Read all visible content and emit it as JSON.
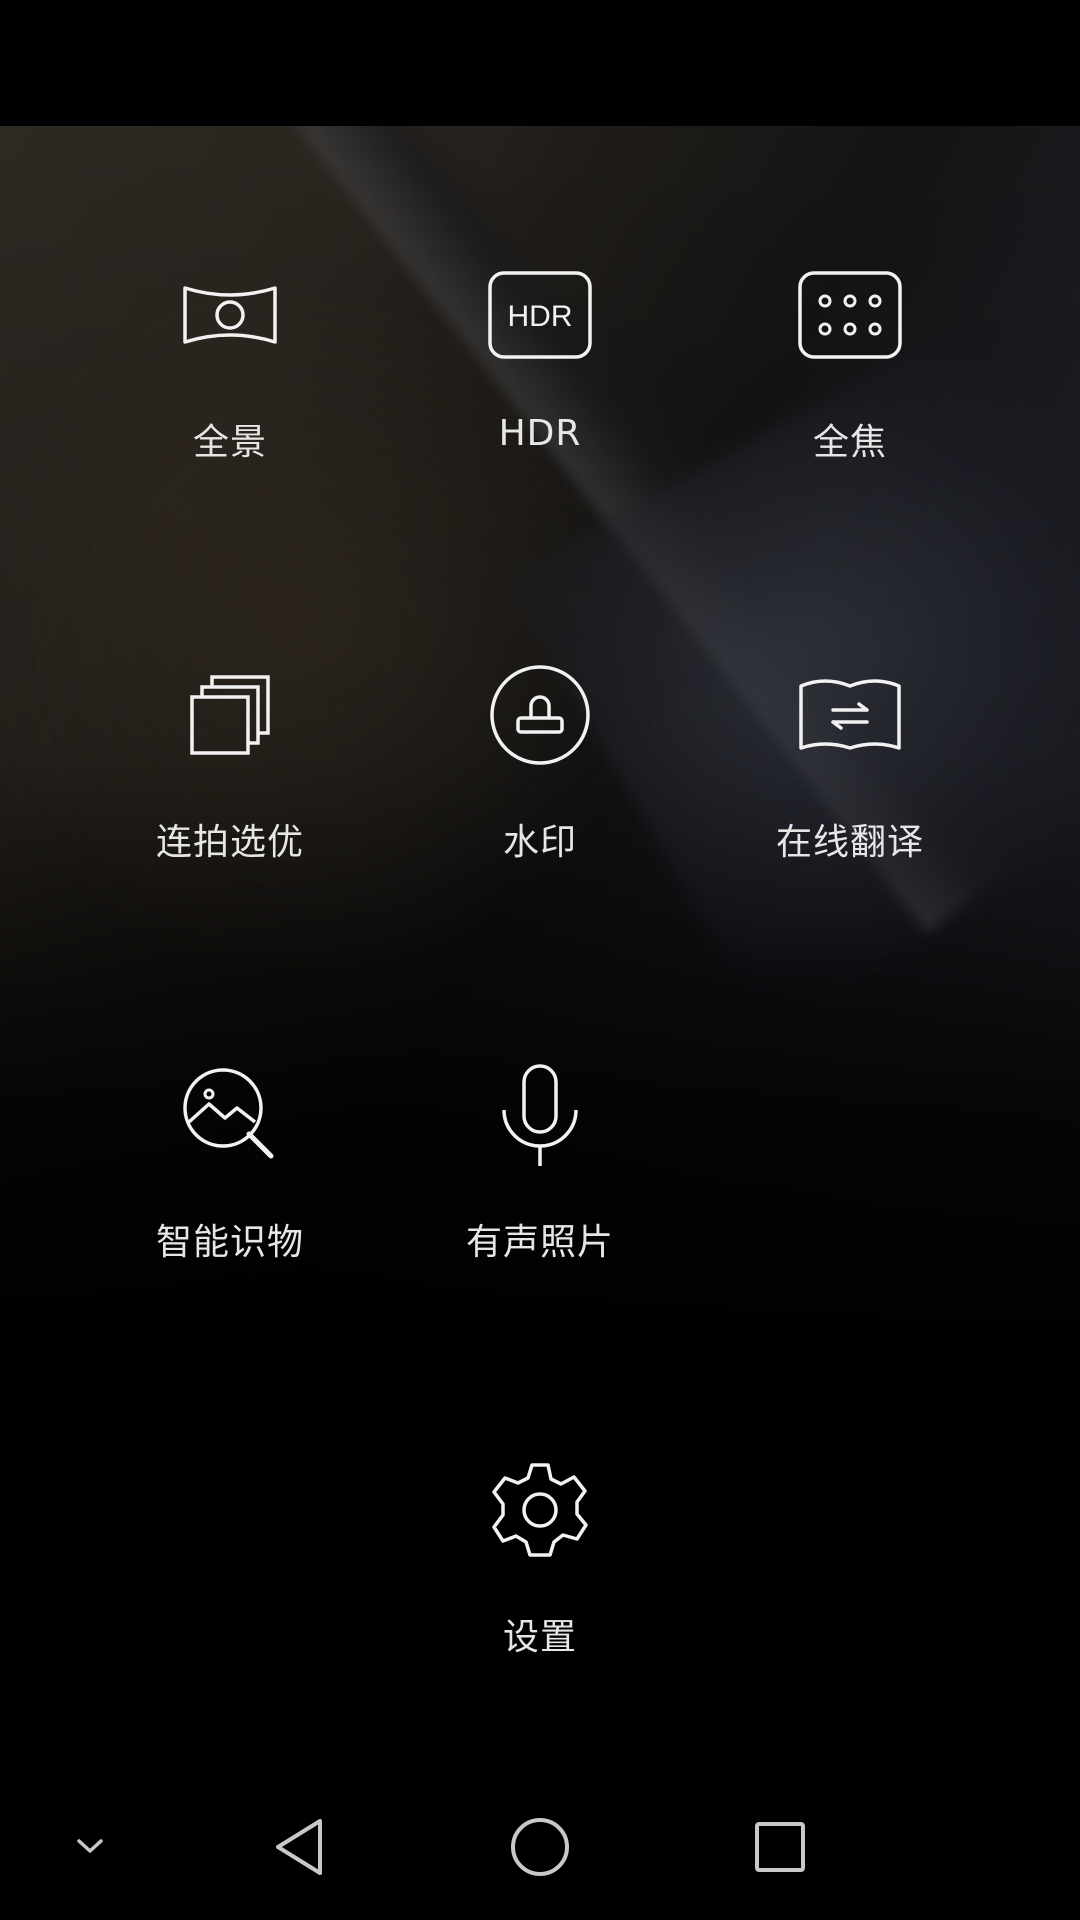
{
  "menu": {
    "items": [
      {
        "label": "全景",
        "icon": "panorama-icon"
      },
      {
        "label": "HDR",
        "icon": "hdr-icon",
        "icon_text": "HDR"
      },
      {
        "label": "全焦",
        "icon": "all-focus-icon"
      },
      {
        "label": "连拍选优",
        "icon": "burst-select-icon"
      },
      {
        "label": "水印",
        "icon": "watermark-stamp-icon"
      },
      {
        "label": "在线翻译",
        "icon": "translate-book-icon"
      },
      {
        "label": "智能识物",
        "icon": "object-recognition-icon"
      },
      {
        "label": "有声照片",
        "icon": "microphone-icon"
      },
      {
        "label": "设置",
        "icon": "gear-icon"
      }
    ]
  },
  "navigation": {
    "collapse": "chevron-down-icon",
    "back": "back-triangle-icon",
    "home": "home-circle-icon",
    "recents": "recents-square-icon"
  },
  "colors": {
    "icon_stroke": "#f2f2f2",
    "label_text": "#e6e6e6",
    "nav_icon": "#c8c8c8",
    "background": "#000000"
  }
}
